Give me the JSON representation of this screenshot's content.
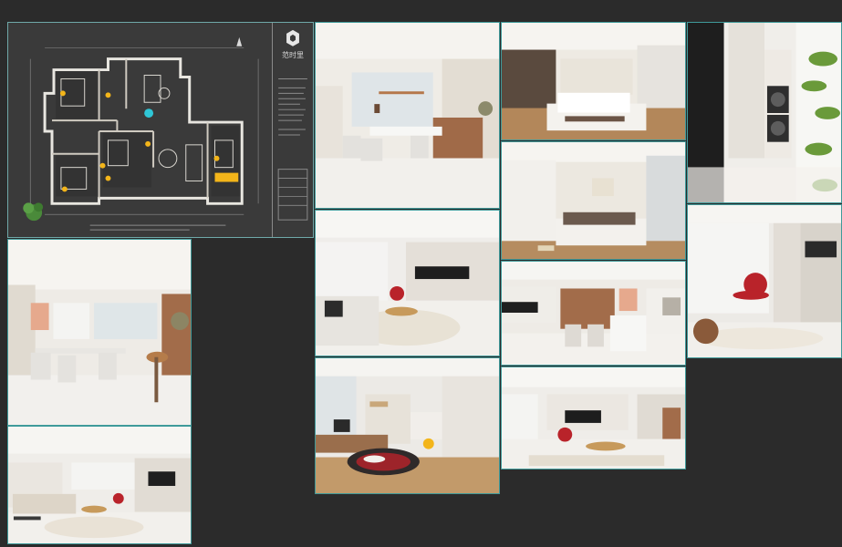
{
  "floor_plan": {
    "logo_text": "范时里"
  },
  "images": [
    {
      "id": "dining-1",
      "icon": "dining-room-render"
    },
    {
      "id": "bedroom-1",
      "icon": "bedroom-render"
    },
    {
      "id": "laundry",
      "icon": "laundry-closet-render"
    },
    {
      "id": "bedroom-2",
      "icon": "bedroom-render"
    },
    {
      "id": "living-1",
      "icon": "living-room-render"
    },
    {
      "id": "living-red",
      "icon": "living-room-render"
    },
    {
      "id": "dining-2",
      "icon": "dining-room-render"
    },
    {
      "id": "kitchen",
      "icon": "kitchen-render"
    },
    {
      "id": "study",
      "icon": "study-room-render"
    },
    {
      "id": "living-2",
      "icon": "living-room-render"
    },
    {
      "id": "living-3",
      "icon": "living-room-render"
    }
  ],
  "colors": {
    "background": "#2b2b2b",
    "tile_border": "#3f9a9a",
    "plan_background": "#3a3a3a",
    "accent_yellow": "#f3b51a",
    "accent_cyan": "#2fc6d6",
    "chair_red": "#b9232a"
  }
}
